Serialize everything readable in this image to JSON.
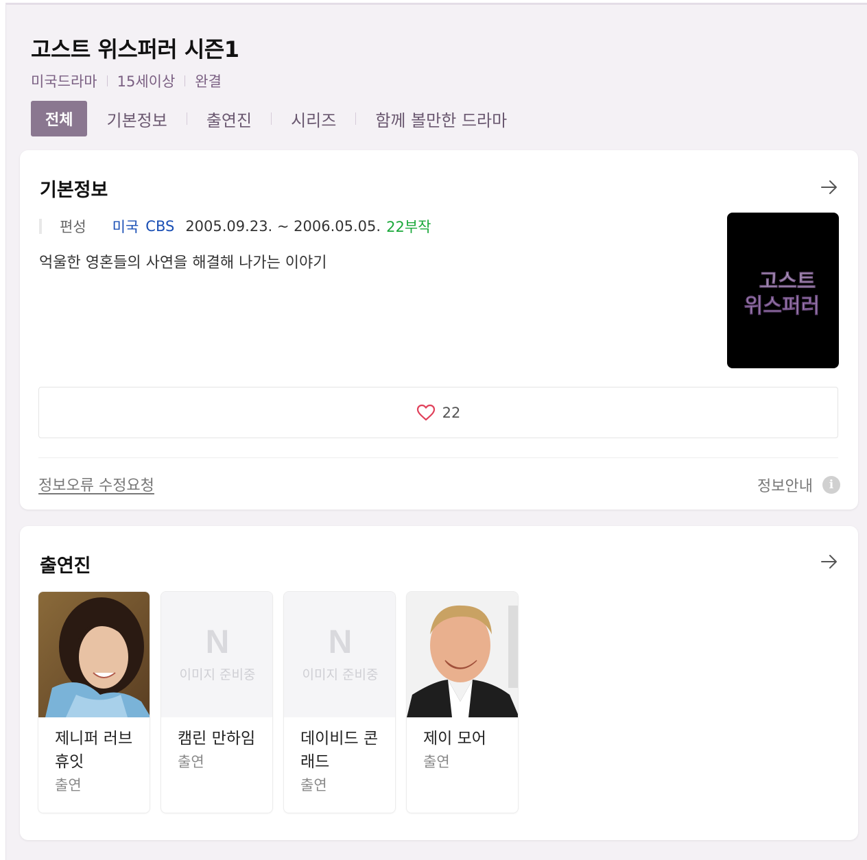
{
  "header": {
    "title": "고스트 위스퍼러 시즌1",
    "meta": [
      "미국드라마",
      "15세이상",
      "완결"
    ],
    "tabs": [
      "전체",
      "기본정보",
      "출연진",
      "시리즈",
      "함께 볼만한 드라마"
    ]
  },
  "basic_info": {
    "title": "기본정보",
    "label": "편성",
    "country": "미국",
    "network": "CBS",
    "dates": "2005.09.23. ~ 2006.05.05.",
    "episodes": "22부작",
    "synopsis": "억울한 영혼들의 사연을 해결해 나가는 이야기",
    "poster_text_line1": "고스트",
    "poster_text_line2": "위스퍼러",
    "likes": "22",
    "report_link": "정보오류 수정요청",
    "info_guide": "정보안내",
    "info_icon": "i"
  },
  "cast": {
    "title": "출연진",
    "placeholder_logo": "N",
    "placeholder_text": "이미지 준비중",
    "members": [
      {
        "name": "제니퍼 러브 휴잇",
        "role": "출연"
      },
      {
        "name": "캠린 만하임",
        "role": "출연"
      },
      {
        "name": "데이비드 콘래드",
        "role": "출연"
      },
      {
        "name": "제이 모어",
        "role": "출연"
      }
    ]
  },
  "colors": {
    "tab_active_bg": "#8a7790",
    "link_blue": "#1a4fb5",
    "episodes_green": "#1aa83a",
    "heart": "#e0405a"
  }
}
